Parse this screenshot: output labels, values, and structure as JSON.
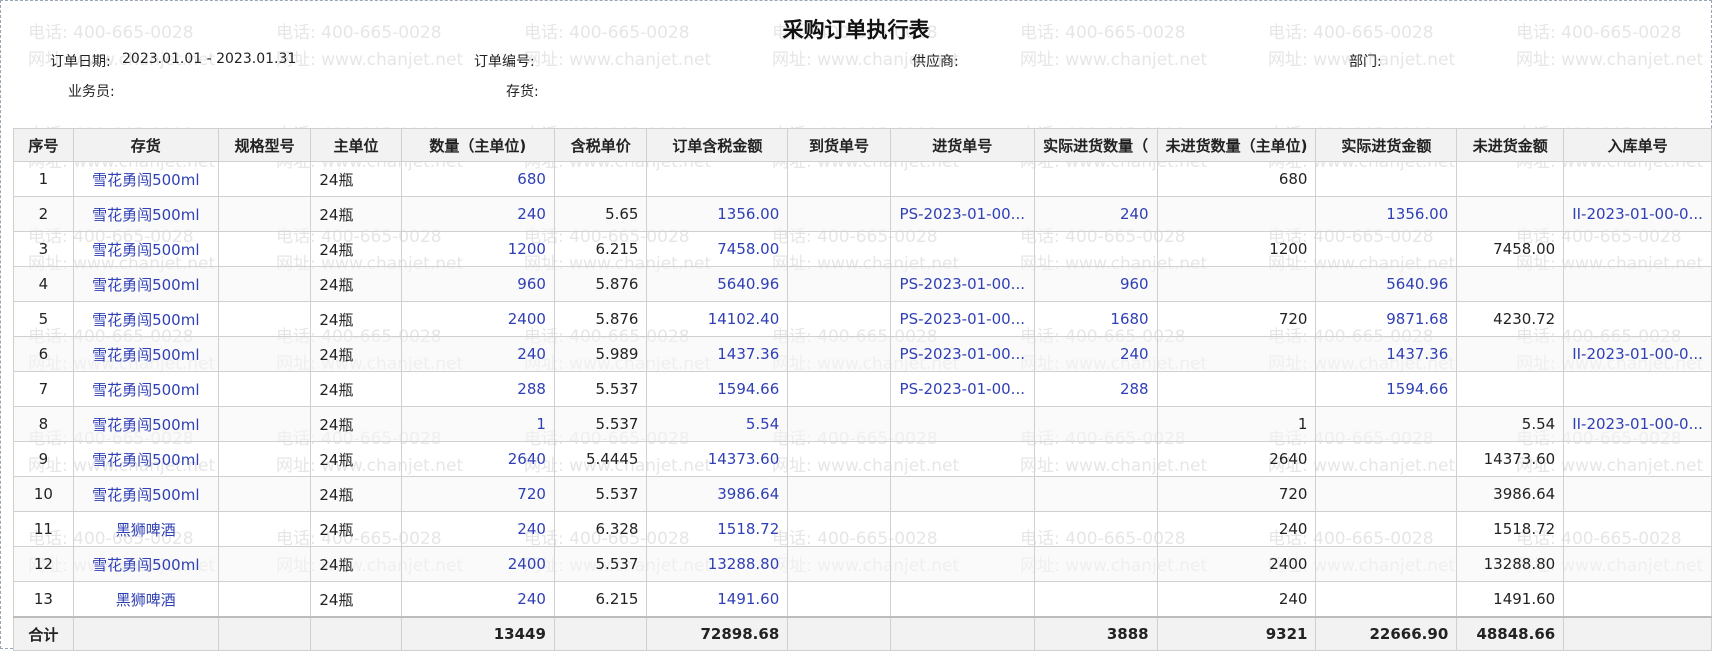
{
  "title": "采购订单执行表",
  "watermark": {
    "phone": "电话: 400-665-0028",
    "site": "网址: www.chanjet.net"
  },
  "filters": {
    "order_date_label": "订单日期:",
    "order_date_value": "2023.01.01 - 2023.01.31",
    "order_no_label": "订单编号:",
    "supplier_label": "供应商:",
    "dept_label": "部门:",
    "salesman_label": "业务员:",
    "stock_label": "存货:"
  },
  "columns": [
    "序号",
    "存货",
    "规格型号",
    "主单位",
    "数量（主单位)",
    "含税单价",
    "订单含税金额",
    "到货单号",
    "进货单号",
    "实际进货数量（",
    "未进货数量（主单位)",
    "实际进货金额",
    "未进货金额",
    "入库单号"
  ],
  "rows": [
    {
      "no": "1",
      "item": "雪花勇闯500ml",
      "spec": "",
      "unit": "24瓶",
      "qty": "680",
      "price": "",
      "amount": "",
      "arrival": "",
      "purchase": "",
      "actual_qty": "",
      "pending_qty": "680",
      "actual_amt": "",
      "pending_amt": "",
      "stockin": ""
    },
    {
      "no": "2",
      "item": "雪花勇闯500ml",
      "spec": "",
      "unit": "24瓶",
      "qty": "240",
      "price": "5.65",
      "amount": "1356.00",
      "arrival": "",
      "purchase": "PS-2023-01-00...",
      "actual_qty": "240",
      "pending_qty": "",
      "actual_amt": "1356.00",
      "pending_amt": "",
      "stockin": "II-2023-01-00-0..."
    },
    {
      "no": "3",
      "item": "雪花勇闯500ml",
      "spec": "",
      "unit": "24瓶",
      "qty": "1200",
      "price": "6.215",
      "amount": "7458.00",
      "arrival": "",
      "purchase": "",
      "actual_qty": "",
      "pending_qty": "1200",
      "actual_amt": "",
      "pending_amt": "7458.00",
      "stockin": ""
    },
    {
      "no": "4",
      "item": "雪花勇闯500ml",
      "spec": "",
      "unit": "24瓶",
      "qty": "960",
      "price": "5.876",
      "amount": "5640.96",
      "arrival": "",
      "purchase": "PS-2023-01-00...",
      "actual_qty": "960",
      "pending_qty": "",
      "actual_amt": "5640.96",
      "pending_amt": "",
      "stockin": ""
    },
    {
      "no": "5",
      "item": "雪花勇闯500ml",
      "spec": "",
      "unit": "24瓶",
      "qty": "2400",
      "price": "5.876",
      "amount": "14102.40",
      "arrival": "",
      "purchase": "PS-2023-01-00...",
      "actual_qty": "1680",
      "pending_qty": "720",
      "actual_amt": "9871.68",
      "pending_amt": "4230.72",
      "stockin": ""
    },
    {
      "no": "6",
      "item": "雪花勇闯500ml",
      "spec": "",
      "unit": "24瓶",
      "qty": "240",
      "price": "5.989",
      "amount": "1437.36",
      "arrival": "",
      "purchase": "PS-2023-01-00...",
      "actual_qty": "240",
      "pending_qty": "",
      "actual_amt": "1437.36",
      "pending_amt": "",
      "stockin": "II-2023-01-00-0..."
    },
    {
      "no": "7",
      "item": "雪花勇闯500ml",
      "spec": "",
      "unit": "24瓶",
      "qty": "288",
      "price": "5.537",
      "amount": "1594.66",
      "arrival": "",
      "purchase": "PS-2023-01-00...",
      "actual_qty": "288",
      "pending_qty": "",
      "actual_amt": "1594.66",
      "pending_amt": "",
      "stockin": ""
    },
    {
      "no": "8",
      "item": "雪花勇闯500ml",
      "spec": "",
      "unit": "24瓶",
      "qty": "1",
      "price": "5.537",
      "amount": "5.54",
      "arrival": "",
      "purchase": "",
      "actual_qty": "",
      "pending_qty": "1",
      "actual_amt": "",
      "pending_amt": "5.54",
      "stockin": "II-2023-01-00-0..."
    },
    {
      "no": "9",
      "item": "雪花勇闯500ml",
      "spec": "",
      "unit": "24瓶",
      "qty": "2640",
      "price": "5.4445",
      "amount": "14373.60",
      "arrival": "",
      "purchase": "",
      "actual_qty": "",
      "pending_qty": "2640",
      "actual_amt": "",
      "pending_amt": "14373.60",
      "stockin": ""
    },
    {
      "no": "10",
      "item": "雪花勇闯500ml",
      "spec": "",
      "unit": "24瓶",
      "qty": "720",
      "price": "5.537",
      "amount": "3986.64",
      "arrival": "",
      "purchase": "",
      "actual_qty": "",
      "pending_qty": "720",
      "actual_amt": "",
      "pending_amt": "3986.64",
      "stockin": ""
    },
    {
      "no": "11",
      "item": "黑狮啤酒",
      "spec": "",
      "unit": "24瓶",
      "qty": "240",
      "price": "6.328",
      "amount": "1518.72",
      "arrival": "",
      "purchase": "",
      "actual_qty": "",
      "pending_qty": "240",
      "actual_amt": "",
      "pending_amt": "1518.72",
      "stockin": ""
    },
    {
      "no": "12",
      "item": "雪花勇闯500ml",
      "spec": "",
      "unit": "24瓶",
      "qty": "2400",
      "price": "5.537",
      "amount": "13288.80",
      "arrival": "",
      "purchase": "",
      "actual_qty": "",
      "pending_qty": "2400",
      "actual_amt": "",
      "pending_amt": "13288.80",
      "stockin": ""
    },
    {
      "no": "13",
      "item": "黑狮啤酒",
      "spec": "",
      "unit": "24瓶",
      "qty": "240",
      "price": "6.215",
      "amount": "1491.60",
      "arrival": "",
      "purchase": "",
      "actual_qty": "",
      "pending_qty": "240",
      "actual_amt": "",
      "pending_amt": "1491.60",
      "stockin": ""
    }
  ],
  "totals": {
    "label": "合计",
    "qty": "13449",
    "amount": "72898.68",
    "actual_qty": "3888",
    "pending_qty": "9321",
    "actual_amt": "22666.90",
    "pending_amt": "48848.66"
  },
  "colors": {
    "link": "#2f3fb5",
    "header_bg": "#f2f2f2",
    "watermark": "#e6e6e6",
    "border": "#d0d0d0"
  }
}
